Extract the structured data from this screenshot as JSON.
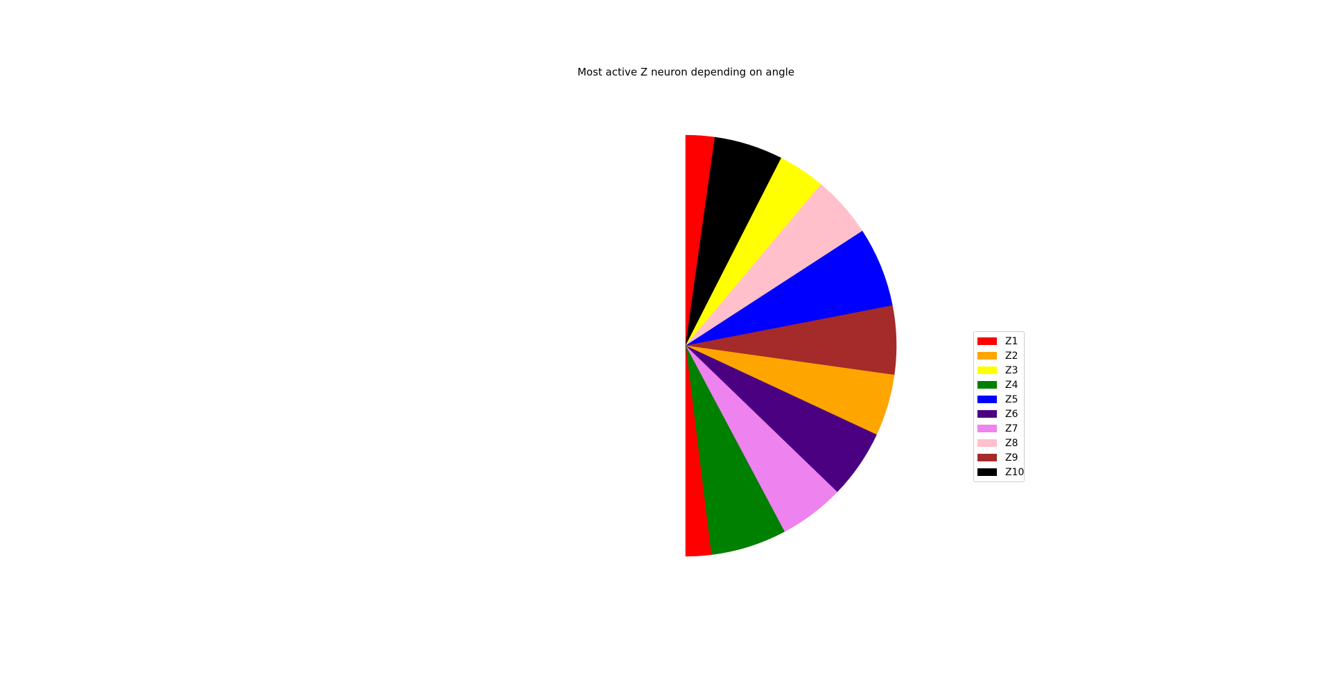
{
  "chart_data": {
    "type": "pie",
    "title": "Most active Z neuron depending on angle",
    "angle_range_deg": [
      90,
      -90
    ],
    "legend_position": "right",
    "segments": [
      {
        "label": "Z1",
        "start_deg": 90,
        "end_deg": 82,
        "color": "#ff0000"
      },
      {
        "label": "Z10",
        "start_deg": 82,
        "end_deg": 63,
        "color": "#000000"
      },
      {
        "label": "Z3",
        "start_deg": 63,
        "end_deg": 50,
        "color": "#ffff00"
      },
      {
        "label": "Z8",
        "start_deg": 50,
        "end_deg": 33,
        "color": "#ffc0cb"
      },
      {
        "label": "Z5",
        "start_deg": 33,
        "end_deg": 11,
        "color": "#0000ff"
      },
      {
        "label": "Z9",
        "start_deg": 11,
        "end_deg": -8,
        "color": "#a52a2a"
      },
      {
        "label": "Z2",
        "start_deg": -8,
        "end_deg": -25,
        "color": "#ffa500"
      },
      {
        "label": "Z6",
        "start_deg": -25,
        "end_deg": -44,
        "color": "#4b0082"
      },
      {
        "label": "Z7",
        "start_deg": -44,
        "end_deg": -62,
        "color": "#ee82ee"
      },
      {
        "label": "Z4",
        "start_deg": -62,
        "end_deg": -83,
        "color": "#008000"
      },
      {
        "label": "Z1",
        "start_deg": -83,
        "end_deg": -90,
        "color": "#ff0000"
      }
    ],
    "legend": [
      {
        "label": "Z1",
        "color": "#ff0000"
      },
      {
        "label": "Z2",
        "color": "#ffa500"
      },
      {
        "label": "Z3",
        "color": "#ffff00"
      },
      {
        "label": "Z4",
        "color": "#008000"
      },
      {
        "label": "Z5",
        "color": "#0000ff"
      },
      {
        "label": "Z6",
        "color": "#4b0082"
      },
      {
        "label": "Z7",
        "color": "#ee82ee"
      },
      {
        "label": "Z8",
        "color": "#ffc0cb"
      },
      {
        "label": "Z9",
        "color": "#a52a2a"
      },
      {
        "label": "Z10",
        "color": "#000000"
      }
    ]
  }
}
